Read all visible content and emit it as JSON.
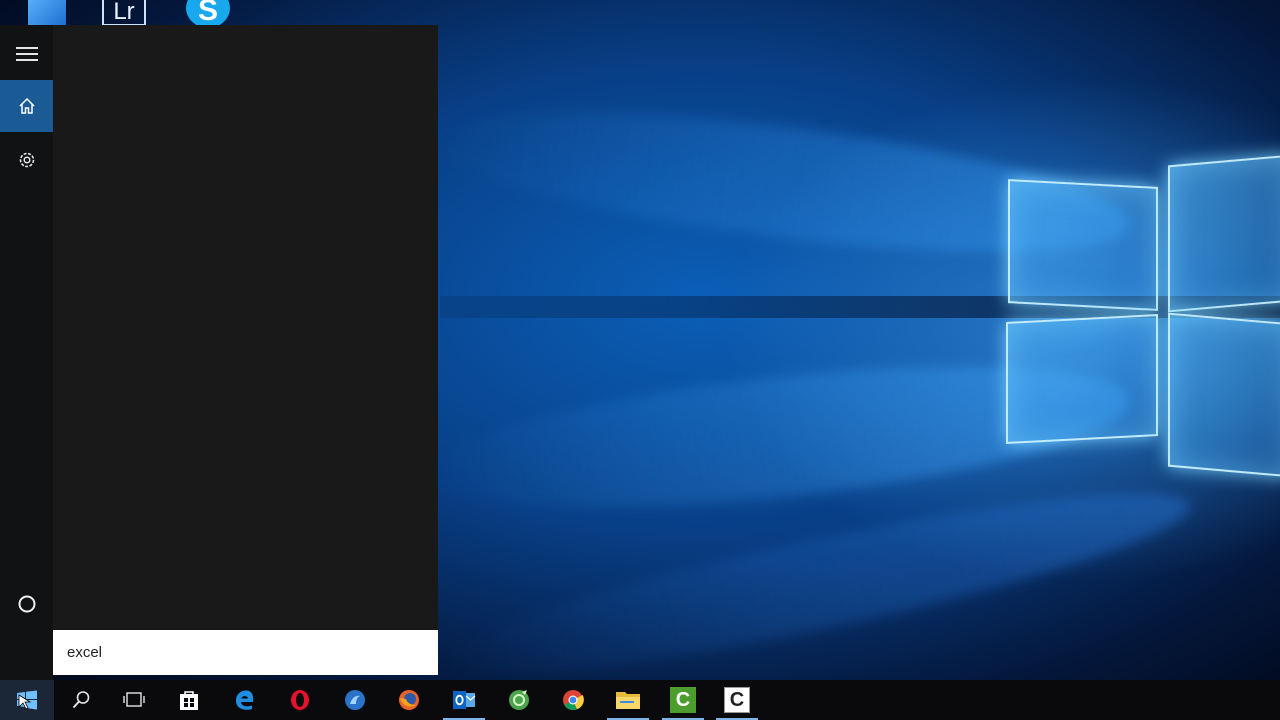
{
  "desktop": {
    "icons": [
      {
        "name": "desktop-app-icon-blue"
      },
      {
        "name": "lightroom-icon",
        "label": "Lr"
      },
      {
        "name": "skype-icon",
        "label": "S"
      }
    ]
  },
  "start_menu": {
    "rail": [
      {
        "name": "hamburger-menu-icon"
      },
      {
        "name": "home-icon",
        "selected": true
      },
      {
        "name": "settings-gear-icon"
      },
      {
        "name": "cortana-circle-icon"
      }
    ],
    "search": {
      "value": "excel"
    },
    "colors": {
      "rail_bg": "#111213",
      "panel_bg": "#191919",
      "home_highlight": "#1a5a95"
    }
  },
  "taskbar": {
    "items": [
      {
        "name": "start-windows-icon"
      },
      {
        "name": "search-magnifier-icon"
      },
      {
        "name": "task-view-icon"
      },
      {
        "name": "store-icon"
      },
      {
        "name": "edge-icon"
      },
      {
        "name": "opera-icon"
      },
      {
        "name": "waterfox-icon"
      },
      {
        "name": "firefox-icon"
      },
      {
        "name": "outlook-icon",
        "label": "O"
      },
      {
        "name": "evernote-green-icon"
      },
      {
        "name": "chrome-icon"
      },
      {
        "name": "file-explorer-icon"
      },
      {
        "name": "camtasia-green-icon",
        "label": "C"
      },
      {
        "name": "camtasia-recorder-icon",
        "label": "C"
      }
    ]
  }
}
